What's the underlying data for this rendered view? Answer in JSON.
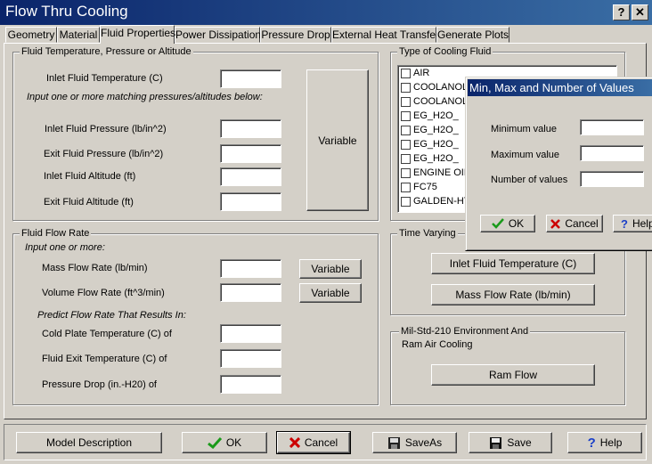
{
  "window": {
    "title": "Flow Thru Cooling",
    "help_btn": "?",
    "close_btn": "✕"
  },
  "tabs": [
    {
      "label": "Geometry"
    },
    {
      "label": "Material"
    },
    {
      "label": "Fluid Properties"
    },
    {
      "label": "Power Dissipation"
    },
    {
      "label": "Pressure Drop"
    },
    {
      "label": "External Heat Transfer"
    },
    {
      "label": "Generate Plots"
    }
  ],
  "active_tab": "Fluid Properties",
  "temp_group": {
    "legend": "Fluid Temperature, Pressure or Altitude",
    "inlet_temp_label": "Inlet Fluid Temperature (C)",
    "hint": "Input one or more matching pressures/altitudes below:",
    "inlet_pressure_label": "Inlet Fluid Pressure (lb/in^2)",
    "exit_pressure_label": "Exit Fluid Pressure (lb/in^2)",
    "inlet_altitude_label": "Inlet Fluid Altitude (ft)",
    "exit_altitude_label": "Exit Fluid Altitude (ft)",
    "variable_btn": "Variable"
  },
  "flow_group": {
    "legend": "Fluid Flow Rate",
    "hint": "Input one or more:",
    "mass_flow_label": "Mass Flow Rate (lb/min)",
    "volume_flow_label": "Volume Flow Rate (ft^3/min)",
    "variable_btn": "Variable",
    "predict_hint": "Predict  Flow Rate That Results In:",
    "cold_plate_label": "Cold Plate Temperature (C) of",
    "exit_temp_label": "Fluid Exit Temperature (C) of",
    "pressure_drop_label": "Pressure Drop (in.-H20) of"
  },
  "cooling_fluid": {
    "legend": "Type of Cooling Fluid",
    "items": [
      {
        "label": "AIR"
      },
      {
        "label": "COOLANOL"
      },
      {
        "label": "COOLANOL"
      },
      {
        "label": "EG_H2O_"
      },
      {
        "label": "EG_H2O_"
      },
      {
        "label": "EG_H2O_"
      },
      {
        "label": "EG_H2O_"
      },
      {
        "label": "ENGINE OIL"
      },
      {
        "label": "FC75"
      },
      {
        "label": "GALDEN-HT"
      }
    ]
  },
  "time_varying": {
    "legend": "Time Varying",
    "inlet_temp_btn": "Inlet Fluid Temperature (C)",
    "mass_flow_btn": "Mass Flow Rate (lb/min)"
  },
  "milstd": {
    "legend": "Mil-Std-210 Environment And",
    "legend2": "Ram Air Cooling",
    "ram_flow_btn": "Ram Flow"
  },
  "dialog": {
    "title": "Min, Max and Number of Values",
    "min_label": "Minimum value",
    "max_label": "Maximum value",
    "num_label": "Number of values",
    "ok_btn": "OK",
    "cancel_btn": "Cancel",
    "help_btn": "Help"
  },
  "bottom": {
    "model_desc_btn": "Model Description",
    "ok_btn": "OK",
    "cancel_btn": "Cancel",
    "saveas_btn": "SaveAs",
    "save_btn": "Save",
    "help_btn": "Help"
  },
  "colors": {
    "title_bar": "#0a246a",
    "ok_check": "#1a9a1a",
    "cancel_x": "#cc0000",
    "help_q": "#1a3fc8"
  },
  "icons": [
    "check-icon",
    "x-icon",
    "floppy-icon",
    "saveas-icon",
    "question-icon"
  ]
}
